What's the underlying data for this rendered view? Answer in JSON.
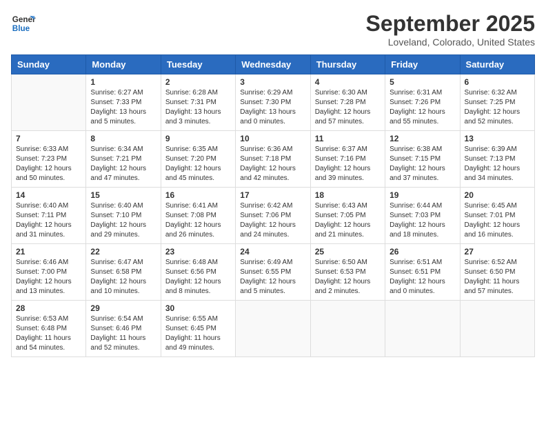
{
  "logo": {
    "line1": "General",
    "line2": "Blue"
  },
  "title": "September 2025",
  "location": "Loveland, Colorado, United States",
  "weekdays": [
    "Sunday",
    "Monday",
    "Tuesday",
    "Wednesday",
    "Thursday",
    "Friday",
    "Saturday"
  ],
  "weeks": [
    [
      {
        "day": "",
        "info": ""
      },
      {
        "day": "1",
        "info": "Sunrise: 6:27 AM\nSunset: 7:33 PM\nDaylight: 13 hours\nand 5 minutes."
      },
      {
        "day": "2",
        "info": "Sunrise: 6:28 AM\nSunset: 7:31 PM\nDaylight: 13 hours\nand 3 minutes."
      },
      {
        "day": "3",
        "info": "Sunrise: 6:29 AM\nSunset: 7:30 PM\nDaylight: 13 hours\nand 0 minutes."
      },
      {
        "day": "4",
        "info": "Sunrise: 6:30 AM\nSunset: 7:28 PM\nDaylight: 12 hours\nand 57 minutes."
      },
      {
        "day": "5",
        "info": "Sunrise: 6:31 AM\nSunset: 7:26 PM\nDaylight: 12 hours\nand 55 minutes."
      },
      {
        "day": "6",
        "info": "Sunrise: 6:32 AM\nSunset: 7:25 PM\nDaylight: 12 hours\nand 52 minutes."
      }
    ],
    [
      {
        "day": "7",
        "info": "Sunrise: 6:33 AM\nSunset: 7:23 PM\nDaylight: 12 hours\nand 50 minutes."
      },
      {
        "day": "8",
        "info": "Sunrise: 6:34 AM\nSunset: 7:21 PM\nDaylight: 12 hours\nand 47 minutes."
      },
      {
        "day": "9",
        "info": "Sunrise: 6:35 AM\nSunset: 7:20 PM\nDaylight: 12 hours\nand 45 minutes."
      },
      {
        "day": "10",
        "info": "Sunrise: 6:36 AM\nSunset: 7:18 PM\nDaylight: 12 hours\nand 42 minutes."
      },
      {
        "day": "11",
        "info": "Sunrise: 6:37 AM\nSunset: 7:16 PM\nDaylight: 12 hours\nand 39 minutes."
      },
      {
        "day": "12",
        "info": "Sunrise: 6:38 AM\nSunset: 7:15 PM\nDaylight: 12 hours\nand 37 minutes."
      },
      {
        "day": "13",
        "info": "Sunrise: 6:39 AM\nSunset: 7:13 PM\nDaylight: 12 hours\nand 34 minutes."
      }
    ],
    [
      {
        "day": "14",
        "info": "Sunrise: 6:40 AM\nSunset: 7:11 PM\nDaylight: 12 hours\nand 31 minutes."
      },
      {
        "day": "15",
        "info": "Sunrise: 6:40 AM\nSunset: 7:10 PM\nDaylight: 12 hours\nand 29 minutes."
      },
      {
        "day": "16",
        "info": "Sunrise: 6:41 AM\nSunset: 7:08 PM\nDaylight: 12 hours\nand 26 minutes."
      },
      {
        "day": "17",
        "info": "Sunrise: 6:42 AM\nSunset: 7:06 PM\nDaylight: 12 hours\nand 24 minutes."
      },
      {
        "day": "18",
        "info": "Sunrise: 6:43 AM\nSunset: 7:05 PM\nDaylight: 12 hours\nand 21 minutes."
      },
      {
        "day": "19",
        "info": "Sunrise: 6:44 AM\nSunset: 7:03 PM\nDaylight: 12 hours\nand 18 minutes."
      },
      {
        "day": "20",
        "info": "Sunrise: 6:45 AM\nSunset: 7:01 PM\nDaylight: 12 hours\nand 16 minutes."
      }
    ],
    [
      {
        "day": "21",
        "info": "Sunrise: 6:46 AM\nSunset: 7:00 PM\nDaylight: 12 hours\nand 13 minutes."
      },
      {
        "day": "22",
        "info": "Sunrise: 6:47 AM\nSunset: 6:58 PM\nDaylight: 12 hours\nand 10 minutes."
      },
      {
        "day": "23",
        "info": "Sunrise: 6:48 AM\nSunset: 6:56 PM\nDaylight: 12 hours\nand 8 minutes."
      },
      {
        "day": "24",
        "info": "Sunrise: 6:49 AM\nSunset: 6:55 PM\nDaylight: 12 hours\nand 5 minutes."
      },
      {
        "day": "25",
        "info": "Sunrise: 6:50 AM\nSunset: 6:53 PM\nDaylight: 12 hours\nand 2 minutes."
      },
      {
        "day": "26",
        "info": "Sunrise: 6:51 AM\nSunset: 6:51 PM\nDaylight: 12 hours\nand 0 minutes."
      },
      {
        "day": "27",
        "info": "Sunrise: 6:52 AM\nSunset: 6:50 PM\nDaylight: 11 hours\nand 57 minutes."
      }
    ],
    [
      {
        "day": "28",
        "info": "Sunrise: 6:53 AM\nSunset: 6:48 PM\nDaylight: 11 hours\nand 54 minutes."
      },
      {
        "day": "29",
        "info": "Sunrise: 6:54 AM\nSunset: 6:46 PM\nDaylight: 11 hours\nand 52 minutes."
      },
      {
        "day": "30",
        "info": "Sunrise: 6:55 AM\nSunset: 6:45 PM\nDaylight: 11 hours\nand 49 minutes."
      },
      {
        "day": "",
        "info": ""
      },
      {
        "day": "",
        "info": ""
      },
      {
        "day": "",
        "info": ""
      },
      {
        "day": "",
        "info": ""
      }
    ]
  ]
}
